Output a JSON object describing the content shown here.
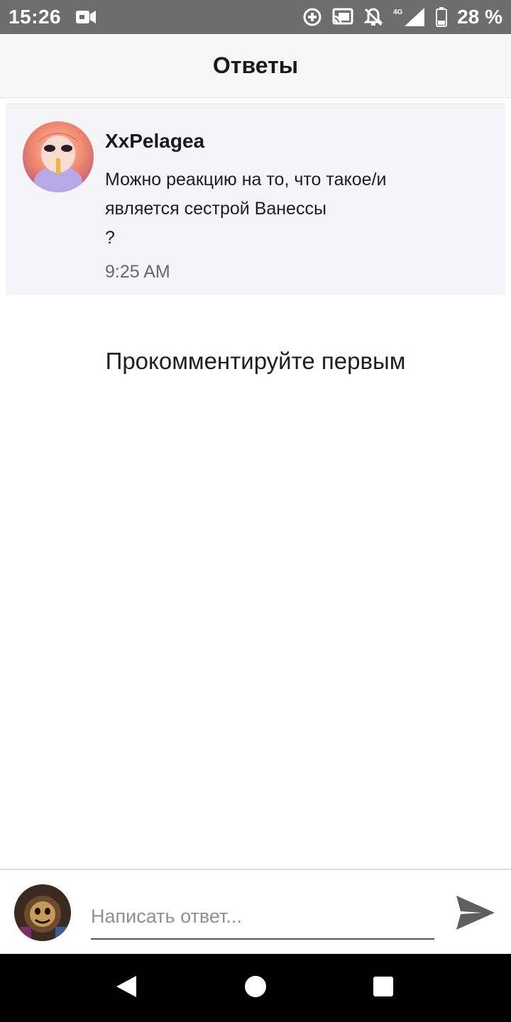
{
  "status_bar": {
    "time": "15:26",
    "battery_text": "28 %",
    "icons": [
      "video-camera-icon",
      "data-saver-icon",
      "cast-icon",
      "notifications-off-icon",
      "4g-signal-icon",
      "battery-icon"
    ]
  },
  "app_bar": {
    "title": "Ответы"
  },
  "comment": {
    "author": "XxPelagea",
    "text": "Можно реакцию на то, что такое/и\nявляется сестрой Ванессы\n?",
    "time": "9:25 AM"
  },
  "empty_state": {
    "text": "Прокомментируйте первым"
  },
  "reply": {
    "placeholder": "Написать ответ..."
  },
  "nav": {
    "icons": [
      "back-icon",
      "home-icon",
      "recents-icon"
    ]
  },
  "colors": {
    "status_bar_bg": "#6d6d6d",
    "app_bar_bg": "#f7f7f7",
    "card_bg": "#f5f4f7",
    "send_icon": "#5f5f5f"
  }
}
